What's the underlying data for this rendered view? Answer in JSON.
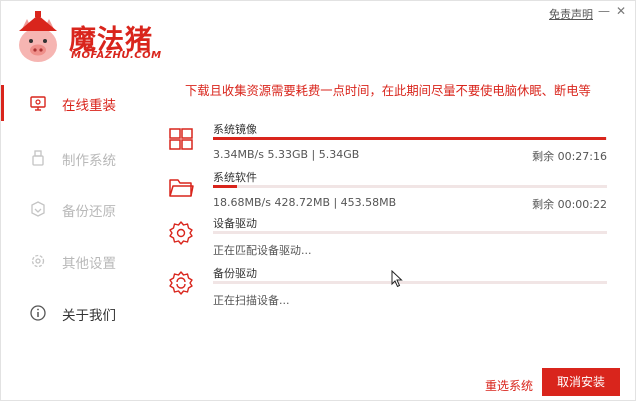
{
  "header": {
    "logo_text": "魔法猪",
    "logo_sub": "MOFAZHU.COM",
    "free_edition": "免责声明",
    "minimize": "—",
    "close": "✕"
  },
  "sidebar": {
    "items": [
      {
        "label": "在线重装",
        "icon": "monitor-icon"
      },
      {
        "label": "制作系统",
        "icon": "usb-icon"
      },
      {
        "label": "备份还原",
        "icon": "backup-icon"
      },
      {
        "label": "其他设置",
        "icon": "gear-icon"
      },
      {
        "label": "关于我们",
        "icon": "info-icon"
      }
    ]
  },
  "main": {
    "warning": "下载且收集资源需要耗费一点时间，在此期间尽量不要使电脑休眠、断电等",
    "tasks": [
      {
        "name": "系统镜像",
        "info": "3.34MB/s 5.33GB | 5.34GB",
        "remaining": "剩余 00:27:16",
        "progress": 0.998,
        "icon": "windows-icon"
      },
      {
        "name": "系统软件",
        "info": "18.68MB/s 428.72MB | 453.58MB",
        "remaining": "剩余 00:00:22",
        "progress": 0.06,
        "icon": "folder-icon"
      },
      {
        "name": "设备驱动",
        "info": "正在匹配设备驱动...",
        "remaining": "",
        "progress": 0,
        "icon": "driver-gear-icon"
      },
      {
        "name": "备份驱动",
        "info": "正在扫描设备...",
        "remaining": "",
        "progress": 0,
        "icon": "backup-driver-icon"
      }
    ]
  },
  "footer": {
    "reselect": "重选系统",
    "cancel": "取消安装"
  },
  "colors": {
    "accent": "#d9251c",
    "inactive": "#b8b8b8"
  }
}
